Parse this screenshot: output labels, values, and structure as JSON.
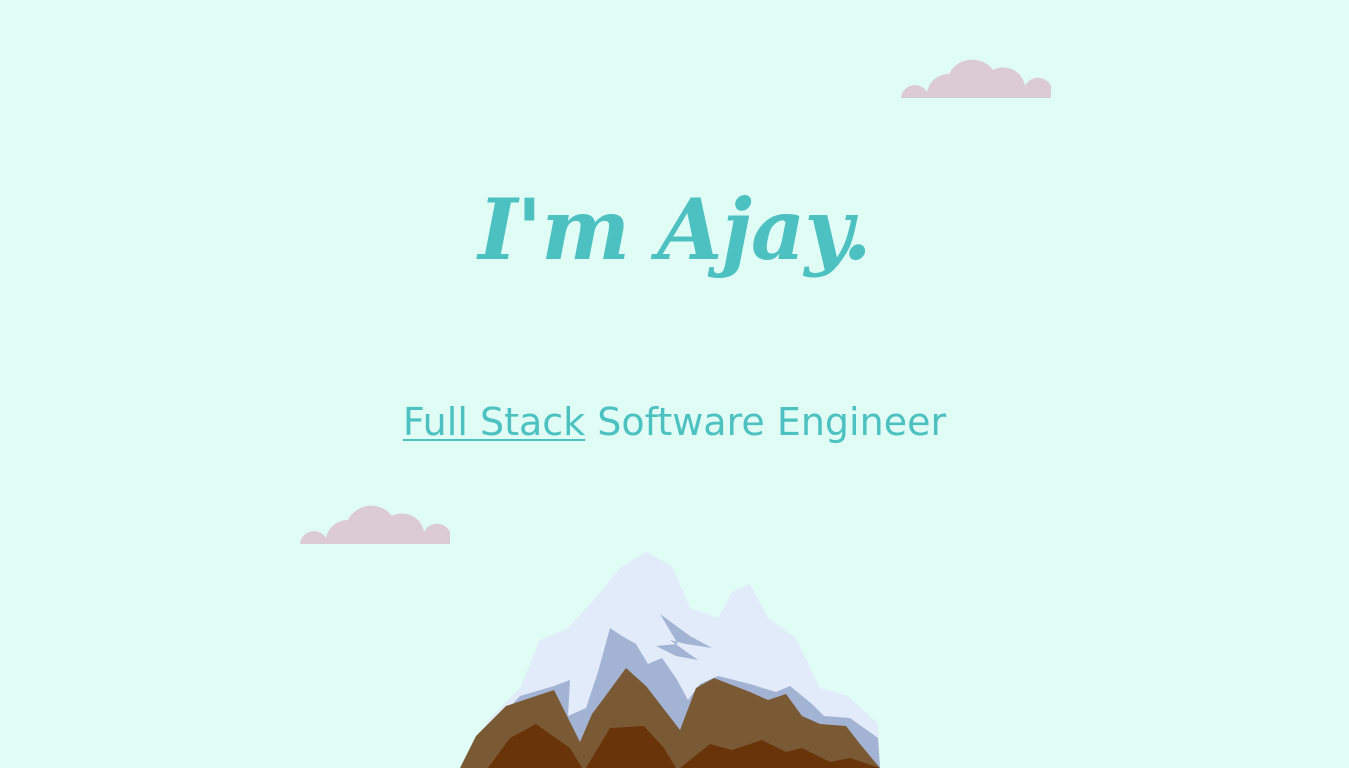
{
  "hero": {
    "greeting": "I'm Ajay.",
    "role_link": "Full Stack",
    "role_rest": " Software Engineer"
  },
  "colors": {
    "background": "#dffcf5",
    "accent": "#4dc1c1",
    "cloud": "#dccbd2",
    "snow": "#e2ebfa",
    "snow_shadow": "#a3b3d4",
    "rock_light": "#7a5a35",
    "rock_dark": "#6a340a"
  },
  "decorations": {
    "clouds": [
      "cloud-icon",
      "cloud-icon"
    ],
    "landscape": "mountain-icon"
  }
}
